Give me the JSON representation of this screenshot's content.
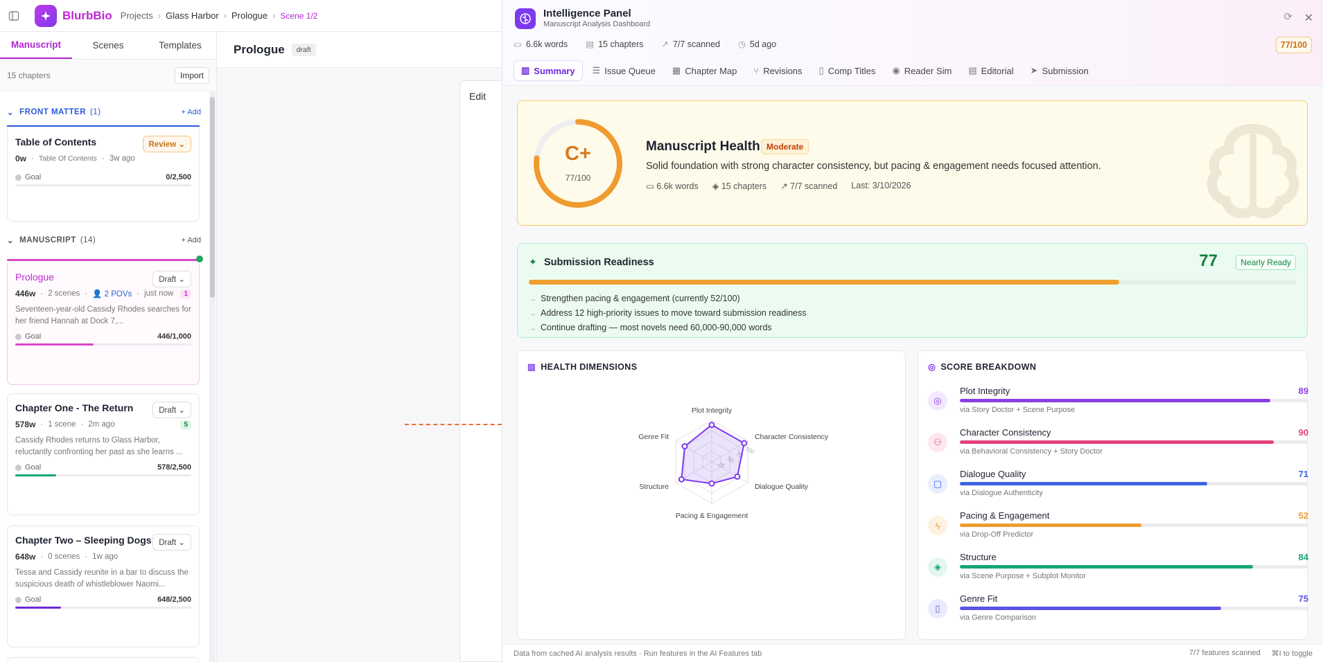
{
  "topbar": {
    "brand": "BlurbBio",
    "breadcrumbs": [
      "Projects",
      "Glass Harbor",
      "Prologue",
      "Scene 1/2"
    ]
  },
  "left": {
    "tabs": [
      "Manuscript",
      "Scenes",
      "Templates"
    ],
    "chapter_count": "15 chapters",
    "import_label": "Import",
    "front_matter": {
      "label": "FRONT MATTER",
      "count": "(1)",
      "add": "+ Add"
    },
    "manuscript": {
      "label": "MANUSCRIPT",
      "count": "(14)",
      "add": "+ Add"
    },
    "cards": [
      {
        "title": "Table of Contents",
        "status": "Review",
        "words": "0w",
        "sub": "Table Of Contents",
        "time": "3w ago",
        "goal_label": "Goal",
        "goal": "0/2,500",
        "progress": 0.0
      },
      {
        "title": "Prologue",
        "status": "Draft",
        "words": "446w",
        "scenes": "2 scenes",
        "povs": "2 POVs",
        "time": "just now",
        "badge": "1",
        "desc": "Seventeen-year-old Cassidy Rhodes searches for her friend Hannah at Dock 7,...",
        "goal_label": "Goal",
        "goal": "446/1,000",
        "progress": 0.446
      },
      {
        "title": "Chapter One - The Return",
        "status": "Draft",
        "words": "578w",
        "scenes": "1 scene",
        "time": "2m ago",
        "badge": "5",
        "desc": "Cassidy Rhodes returns to Glass Harbor, reluctantly confronting her past as she learns ...",
        "goal_label": "Goal",
        "goal": "578/2,500",
        "progress": 0.231
      },
      {
        "title": "Chapter Two – Sleeping Dogs",
        "status": "Draft",
        "words": "648w",
        "scenes": "0 scenes",
        "time": "1w ago",
        "desc": "Tessa and Cassidy reunite in a bar to discuss the suspicious death of whistleblower Naomi...",
        "goal_label": "Goal",
        "goal": "648/2,500",
        "progress": 0.259
      }
    ]
  },
  "middle": {
    "title": "Prologue",
    "chip": "draft",
    "edit_tab": "Edit"
  },
  "panel": {
    "title": "Intelligence Panel",
    "subtitle": "Manuscript Analysis Dashboard",
    "stats": [
      "6.6k words",
      "15 chapters",
      "7/7 scanned",
      "5d ago"
    ],
    "score": "77/100",
    "tabs": [
      "Summary",
      "Issue Queue",
      "Chapter Map",
      "Revisions",
      "Comp Titles",
      "Reader Sim",
      "Editorial",
      "Submission"
    ],
    "health": {
      "grade": "C+",
      "score": "77/100",
      "score_value": 77,
      "title": "Manuscript Health",
      "chip": "Moderate",
      "desc": "Solid foundation with strong character consistency, but pacing & engagement needs focused attention.",
      "stats": [
        "6.6k words",
        "15 chapters",
        "7/7 scanned",
        "Last: 3/10/2026"
      ]
    },
    "readiness": {
      "title": "Submission Readiness",
      "score": "77",
      "score_value": 77,
      "chip": "Nearly Ready",
      "items": [
        "Strengthen pacing & engagement (currently 52/100)",
        "Address 12 high-priority issues to move toward submission readiness",
        "Continue drafting — most novels need 60,000-90,000 words"
      ]
    },
    "dimensions": {
      "title": "HEALTH DIMENSIONS",
      "axes": [
        "Plot Integrity",
        "Character Consistency",
        "Dialogue Quality",
        "Pacing & Engagement",
        "Structure",
        "Genre Fit"
      ],
      "values": [
        89,
        90,
        71,
        52,
        84,
        75
      ],
      "rings": [
        "25",
        "50",
        "75",
        "100"
      ],
      "ring_values": [
        25,
        50,
        75,
        100
      ]
    },
    "breakdown": {
      "title": "SCORE BREAKDOWN",
      "rows": [
        {
          "name": "Plot Integrity",
          "value": "89",
          "num": 89,
          "via": "via Story Doctor + Scene Purpose",
          "color": "#8b3fe0",
          "bg": "#f3e8ff",
          "icon": "target-icon"
        },
        {
          "name": "Character Consistency",
          "value": "90",
          "num": 90,
          "via": "via Behavioral Consistency + Story Doctor",
          "color": "#e2407c",
          "bg": "#fde8f0",
          "icon": "users-icon"
        },
        {
          "name": "Dialogue Quality",
          "value": "71",
          "num": 71,
          "via": "via Dialogue Authenticity",
          "color": "#3b63e6",
          "bg": "#e8eefd",
          "icon": "message-icon"
        },
        {
          "name": "Pacing & Engagement",
          "value": "52",
          "num": 52,
          "via": "via Drop-Off Predictor",
          "color": "#ef9b2f",
          "bg": "#fdf1e1",
          "icon": "bolt-icon"
        },
        {
          "name": "Structure",
          "value": "84",
          "num": 84,
          "via": "via Scene Purpose + Subplot Monitor",
          "color": "#17a571",
          "bg": "#e3f7ee",
          "icon": "layers-icon"
        },
        {
          "name": "Genre Fit",
          "value": "75",
          "num": 75,
          "via": "via Genre Comparison",
          "color": "#5a52e6",
          "bg": "#ebeafd",
          "icon": "book-icon"
        }
      ]
    },
    "footer": {
      "left": "Data from cached AI analysis results · Run features in the AI Features tab",
      "scanned": "7/7 features scanned",
      "shortcut": "⌘I to toggle"
    }
  },
  "colors": {
    "accent": "#b026d3",
    "purple": "#7c3aed",
    "orange": "#ef9b2f",
    "green": "#15803d"
  }
}
